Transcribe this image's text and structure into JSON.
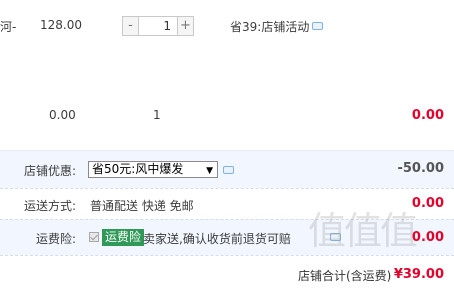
{
  "item1": {
    "name_fragment": "河-",
    "price": "128.00",
    "quantity": "1",
    "minus": "-",
    "plus": "+",
    "promo": "省39:店铺活动"
  },
  "item2": {
    "price": "0.00",
    "quantity": "1",
    "subtotal": "0.00"
  },
  "store_discount": {
    "label": "店铺优惠:",
    "selected_option": "省50元:风中爆发",
    "amount": "-50.00"
  },
  "shipping": {
    "label": "运送方式:",
    "methods": "普通配送 快递 免邮",
    "amount": "0.00"
  },
  "insurance": {
    "label": "运费险:",
    "badge": "运费险",
    "description": "卖家送,确认收货前退货可赔",
    "amount": "0.00"
  },
  "total": {
    "label": "店铺合计(含运费)",
    "value": "¥39.00"
  },
  "watermark": "值值值",
  "colors": {
    "price_red": "#e4002b",
    "row_highlight": "#f2f7ff",
    "insurance_green": "#2f9a57"
  },
  "icons": [
    "bubble-icon",
    "checkbox-checked-icon",
    "dropdown-arrow-icon"
  ]
}
